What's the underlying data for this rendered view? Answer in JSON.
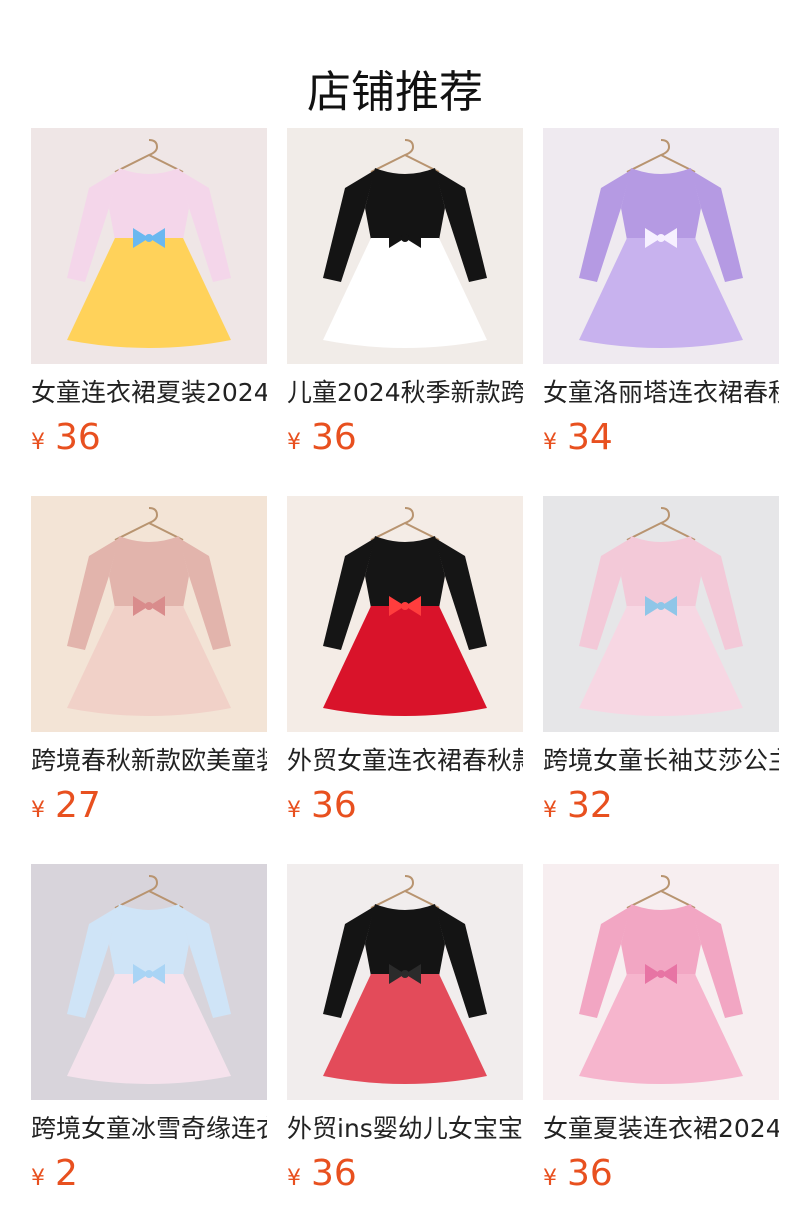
{
  "page": {
    "title": "店铺推荐"
  },
  "products": [
    {
      "title": "女童连衣裙夏装2024",
      "currency": "¥",
      "price": "36",
      "image": "floral-fruit-print-dress",
      "bg": "#efe6e6",
      "colors": {
        "top": "#f4d6ea",
        "skirt": "#ffd25a",
        "accent": "#6ab8f0"
      }
    },
    {
      "title": "儿童2024秋季新款跨",
      "currency": "¥",
      "price": "36",
      "image": "black-heart-dress",
      "bg": "#f1ece8",
      "colors": {
        "top": "#141414",
        "skirt": "#ffffff",
        "accent": "#141414"
      }
    },
    {
      "title": "女童洛丽塔连衣裙春秋",
      "currency": "¥",
      "price": "34",
      "image": "purple-lolita-dress",
      "bg": "#efeaf0",
      "colors": {
        "top": "#b59ae3",
        "skirt": "#c8b2ee",
        "accent": "#f6f0ff"
      }
    },
    {
      "title": "跨境春秋新款欧美童装",
      "currency": "¥",
      "price": "27",
      "image": "pink-knit-tulle-dress",
      "bg": "#f3e4d6",
      "colors": {
        "top": "#e2b4ac",
        "skirt": "#f1d1c8",
        "accent": "#d98c8c"
      }
    },
    {
      "title": "外贸女童连衣裙春秋款",
      "currency": "¥",
      "price": "36",
      "image": "red-dot-tulle-dress",
      "bg": "#f4ece6",
      "colors": {
        "top": "#151515",
        "skirt": "#d9132a",
        "accent": "#ff3d3d"
      }
    },
    {
      "title": "跨境女童长袖艾莎公主",
      "currency": "¥",
      "price": "32",
      "image": "girl-pink-princess-dress",
      "bg": "#e6e6e8",
      "colors": {
        "top": "#f3c9d8",
        "skirt": "#f7d7e3",
        "accent": "#8fc6e8"
      }
    },
    {
      "title": "跨境女童冰雪奇缘连衣",
      "currency": "¥",
      "price": "2",
      "image": "rainbow-tulle-frozen-dress",
      "bg": "#d8d4db",
      "colors": {
        "top": "#cfe4f7",
        "skirt": "#f5e2ec",
        "accent": "#a9d4f5"
      }
    },
    {
      "title": "外贸ins婴幼儿女宝宝",
      "currency": "¥",
      "price": "36",
      "image": "red-plaid-dress",
      "bg": "#f1eded",
      "colors": {
        "top": "#141414",
        "skirt": "#e34b5a",
        "accent": "#2b2b2b"
      }
    },
    {
      "title": "女童夏装连衣裙2024",
      "currency": "¥",
      "price": "36",
      "image": "pink-butterfly-dress",
      "bg": "#f7eef0",
      "colors": {
        "top": "#f2a6c3",
        "skirt": "#f6b5cd",
        "accent": "#e774a4"
      }
    }
  ]
}
